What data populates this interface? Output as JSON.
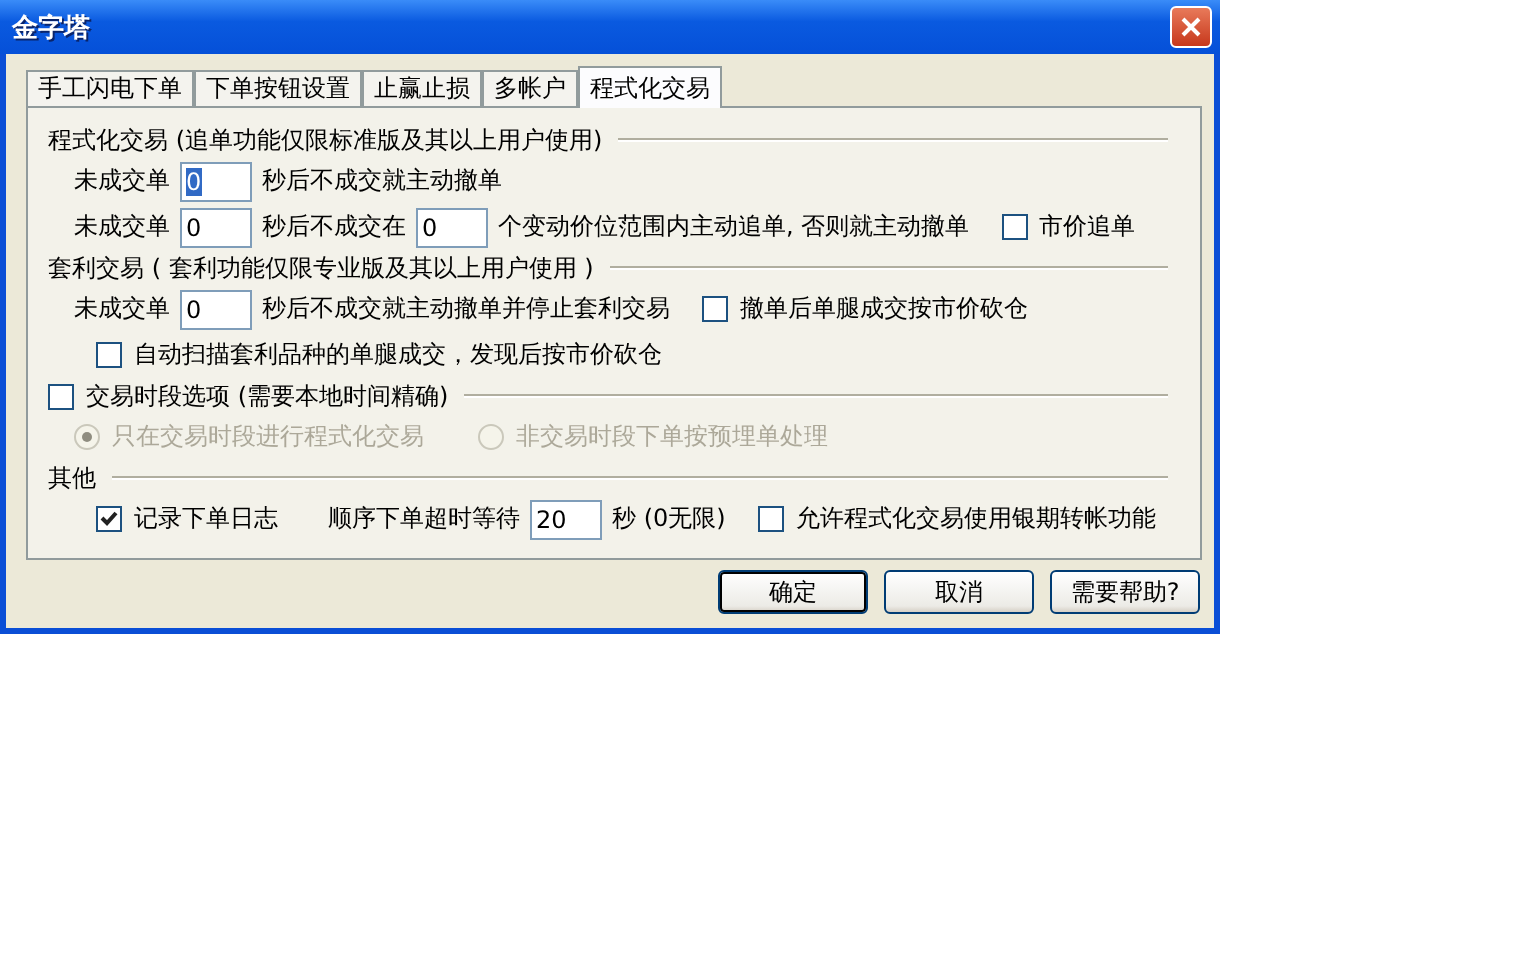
{
  "window": {
    "title": "金字塔"
  },
  "tabs": [
    {
      "label": "手工闪电下单",
      "selected": false
    },
    {
      "label": "下单按钮设置",
      "selected": false
    },
    {
      "label": "止赢止损",
      "selected": false
    },
    {
      "label": "多帐户",
      "selected": false
    },
    {
      "label": "程式化交易",
      "selected": true
    }
  ],
  "sections": [
    {
      "header": {
        "kind": "text",
        "label": "程式化交易 (追单功能仅限标准版及其以上用户使用)"
      },
      "rows": [
        [
          {
            "kind": "text",
            "text": "未成交单"
          },
          {
            "kind": "input",
            "value": "0",
            "selected": true
          },
          {
            "kind": "text",
            "text": "秒后不成交就主动撤单"
          }
        ],
        [
          {
            "kind": "text",
            "text": "未成交单"
          },
          {
            "kind": "input",
            "value": "0",
            "selected": false
          },
          {
            "kind": "text",
            "text": "秒后不成交在"
          },
          {
            "kind": "input",
            "value": "0",
            "selected": false
          },
          {
            "kind": "text",
            "text": "个变动价位范围内主动追单, 否则就主动撤单"
          },
          {
            "kind": "checkbox",
            "label": "市价追单",
            "checked": false
          }
        ]
      ]
    },
    {
      "header": {
        "kind": "text",
        "label": "套利交易 ( 套利功能仅限专业版及其以上用户使用 )"
      },
      "rows": [
        [
          {
            "kind": "text",
            "text": "未成交单"
          },
          {
            "kind": "input",
            "value": "0",
            "selected": false
          },
          {
            "kind": "text",
            "text": "秒后不成交就主动撤单并停止套利交易"
          },
          {
            "kind": "checkbox",
            "label": "撤单后单腿成交按市价砍仓",
            "checked": false
          }
        ],
        [
          {
            "kind": "checkbox",
            "label": "自动扫描套利品种的单腿成交，发现后按市价砍仓",
            "checked": false
          }
        ]
      ]
    },
    {
      "header": {
        "kind": "checkbox",
        "label": "交易时段选项 (需要本地时间精确)",
        "checked": false
      },
      "rows": [
        [
          {
            "kind": "radio",
            "label": "只在交易时段进行程式化交易",
            "selected": true,
            "disabled": true
          },
          {
            "kind": "radio",
            "label": "非交易时段下单按预埋单处理",
            "selected": false,
            "disabled": true
          }
        ]
      ]
    },
    {
      "header": {
        "kind": "text",
        "label": "其他"
      },
      "rows": [
        [
          {
            "kind": "checkbox",
            "label": "记录下单日志",
            "checked": true
          },
          {
            "kind": "text",
            "text": "顺序下单超时等待"
          },
          {
            "kind": "input",
            "value": "20",
            "selected": false
          },
          {
            "kind": "text",
            "text": "秒 (0无限)"
          },
          {
            "kind": "checkbox",
            "label": "允许程式化交易使用银期转帐功能",
            "checked": false
          }
        ]
      ]
    }
  ],
  "buttons": [
    {
      "label": "确定",
      "default": true
    },
    {
      "label": "取消",
      "default": false
    },
    {
      "label": "需要帮助?",
      "default": false
    }
  ]
}
